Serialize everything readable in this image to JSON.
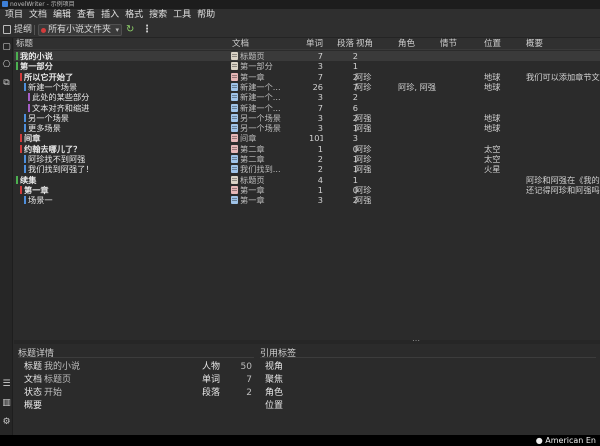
{
  "window": {
    "title": "novelWriter - 示例项目"
  },
  "menu": [
    "项目",
    "文档",
    "编辑",
    "查看",
    "插入",
    "格式",
    "搜索",
    "工具",
    "帮助"
  ],
  "toolbar": {
    "outline_label": "提纲",
    "root_select": "所有小说文件夹"
  },
  "colors": {
    "red": "#d23c3c",
    "blue": "#4e8fdc",
    "green": "#4caf50",
    "purple": "#a45fc7",
    "page_icon": "#d9d2c5",
    "chapter_icon": "#e6b7b7",
    "scene_icon": "#9fc3e8"
  },
  "outline": {
    "columns": [
      "标题",
      "文档",
      "单词",
      "段落",
      "视角",
      "角色",
      "情节",
      "位置",
      "概要"
    ],
    "rows": [
      {
        "title": "我的小说",
        "level": 0,
        "bar": "green",
        "icon": "page",
        "doc": "标题页",
        "words": "7",
        "paras": "2",
        "pov": "",
        "chars": "",
        "plot": "",
        "loc": "",
        "synopsis": "",
        "selected": true
      },
      {
        "title": "第一部分",
        "level": 0,
        "bar": "green",
        "icon": "page",
        "doc": "第一部分",
        "words": "3",
        "paras": "1",
        "pov": "",
        "chars": "",
        "plot": "",
        "loc": "",
        "synopsis": ""
      },
      {
        "title": "所以它开始了",
        "level": 1,
        "bar": "red",
        "icon": "chapter",
        "doc": "第一章",
        "words": "7",
        "paras": "2",
        "pov": "阿珍",
        "chars": "",
        "plot": "",
        "loc": "地球",
        "synopsis": "我们可以添加章节文"
      },
      {
        "title": "新建一个场景",
        "level": 2,
        "bar": "blue",
        "icon": "scene",
        "doc": "新建一个...",
        "words": "26",
        "paras": "7",
        "pov": "阿珍",
        "chars": "阿珍, 阿强",
        "plot": "",
        "loc": "地球",
        "synopsis": ""
      },
      {
        "title": "此处的某些部分",
        "level": 3,
        "bar": "purple",
        "icon": "scene",
        "doc": "新建一个...",
        "words": "3",
        "paras": "2",
        "pov": "",
        "chars": "",
        "plot": "",
        "loc": "",
        "synopsis": ""
      },
      {
        "title": "文本对齐和缩进",
        "level": 3,
        "bar": "purple",
        "icon": "scene",
        "doc": "新建一个...",
        "words": "7",
        "paras": "6",
        "pov": "",
        "chars": "",
        "plot": "",
        "loc": "",
        "synopsis": ""
      },
      {
        "title": "另一个场景",
        "level": 2,
        "bar": "blue",
        "icon": "scene",
        "doc": "另一个场景",
        "words": "3",
        "paras": "2",
        "pov": "阿强",
        "chars": "",
        "plot": "",
        "loc": "地球",
        "synopsis": ""
      },
      {
        "title": "更多场景",
        "level": 2,
        "bar": "blue",
        "icon": "scene",
        "doc": "另一个场景",
        "words": "3",
        "paras": "1",
        "pov": "阿强",
        "chars": "",
        "plot": "",
        "loc": "地球",
        "synopsis": ""
      },
      {
        "title": "间章",
        "level": 1,
        "bar": "red",
        "icon": "chapter",
        "doc": "间章",
        "words": "101",
        "paras": "3",
        "pov": "",
        "chars": "",
        "plot": "",
        "loc": "",
        "synopsis": ""
      },
      {
        "title": "约翰去哪儿了？",
        "level": 1,
        "bar": "red",
        "icon": "chapter",
        "doc": "第二章",
        "words": "1",
        "paras": "0",
        "pov": "阿珍",
        "chars": "",
        "plot": "",
        "loc": "太空",
        "synopsis": ""
      },
      {
        "title": "阿珍找不到阿强",
        "level": 2,
        "bar": "blue",
        "icon": "scene",
        "doc": "第二章",
        "words": "2",
        "paras": "1",
        "pov": "阿珍",
        "chars": "",
        "plot": "",
        "loc": "太空",
        "synopsis": ""
      },
      {
        "title": "我们找到阿强了！",
        "level": 2,
        "bar": "blue",
        "icon": "scene",
        "doc": "我们找到...",
        "words": "2",
        "paras": "1",
        "pov": "阿强",
        "chars": "",
        "plot": "",
        "loc": "火星",
        "synopsis": ""
      },
      {
        "title": "续集",
        "level": 0,
        "bar": "green",
        "icon": "page",
        "doc": "标题页",
        "words": "4",
        "paras": "1",
        "pov": "",
        "chars": "",
        "plot": "",
        "loc": "",
        "synopsis": "阿珍和阿强在《我的"
      },
      {
        "title": "第一章",
        "level": 1,
        "bar": "red",
        "icon": "chapter",
        "doc": "第一章",
        "words": "1",
        "paras": "0",
        "pov": "阿珍",
        "chars": "",
        "plot": "",
        "loc": "",
        "synopsis": "还记得阿珍和阿强吗"
      },
      {
        "title": "场景一",
        "level": 2,
        "bar": "blue",
        "icon": "scene",
        "doc": "第一章",
        "words": "3",
        "paras": "2",
        "pov": "阿强",
        "chars": "",
        "plot": "",
        "loc": "",
        "synopsis": ""
      }
    ]
  },
  "details": {
    "header": "标题详情",
    "title_label": "标题",
    "title_value": "我的小说",
    "doc_label": "文档",
    "doc_value": "标题页",
    "status_label": "状态",
    "status_value": "开始",
    "synopsis_label": "概要",
    "chars_label": "人物",
    "chars_value": "50",
    "words_label": "单词",
    "words_value": "7",
    "paras_label": "段落",
    "paras_value": "2"
  },
  "tags": {
    "header": "引用标签",
    "items": [
      "视角",
      "聚焦",
      "角色",
      "位置"
    ]
  },
  "status": {
    "language": "American En"
  }
}
